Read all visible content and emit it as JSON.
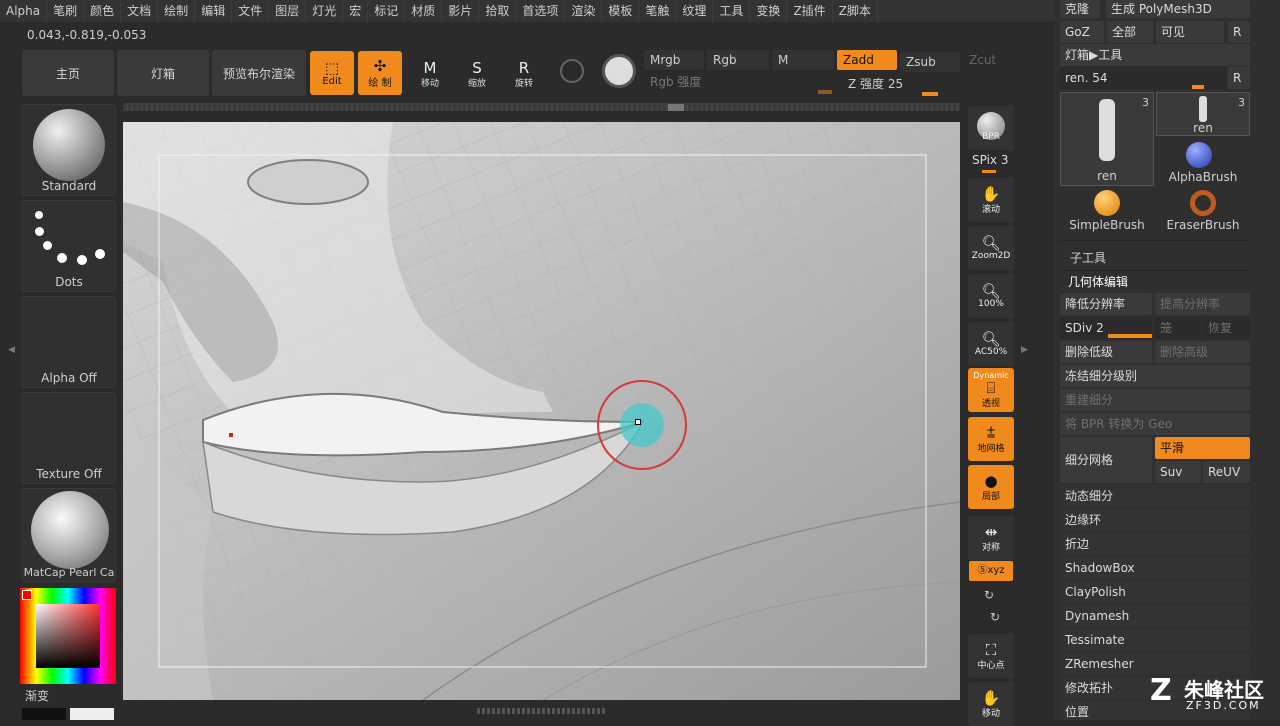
{
  "menu": [
    "Alpha",
    "笔刷",
    "颜色",
    "文档",
    "绘制",
    "编辑",
    "文件",
    "图层",
    "灯光",
    "宏",
    "标记",
    "材质",
    "影片",
    "拾取",
    "首选项",
    "渲染",
    "模板",
    "笔触",
    "纹理",
    "工具",
    "变换",
    "Z插件",
    "Z脚本"
  ],
  "coords": "0.043,-0.819,-0.053",
  "toolbar": {
    "home": "主页",
    "lightbox": "灯箱",
    "bpr_preview": "预览布尔渲染",
    "edit": "Edit",
    "draw": "绘 制",
    "move": "移动",
    "scale": "缩放",
    "rotate": "旋转",
    "mrgb": "Mrgb",
    "rgb": "Rgb",
    "m": "M",
    "zadd": "Zadd",
    "zsub": "Zsub",
    "zcut": "Zcut",
    "rgb_intensity": "Rgb 强度",
    "z_intensity": "Z 强度 25"
  },
  "left": {
    "brush": "Standard",
    "stroke": "Dots",
    "alpha": "Alpha Off",
    "texture": "Texture Off",
    "material": "MatCap Pearl Ca",
    "gradient": "渐变"
  },
  "right_tools": {
    "bpr": "BPR",
    "spix": "SPix 3",
    "scroll": "滚动",
    "zoom2d": "Zoom2D",
    "zoom100": "100%",
    "ac50": "AC50%",
    "dynamic": "Dynamic",
    "persp": "透视",
    "floor": "地网格",
    "local": "局部",
    "frame": "对称",
    "xyz": "Ⓢxyz",
    "center": "中心点",
    "move": "移动"
  },
  "panel": {
    "clone": "克隆",
    "make_polymesh": "生成 PolyMesh3D",
    "goz": "GoZ",
    "all": "全部",
    "visible": "可见",
    "r": "R",
    "lightbox_tools": "灯箱▶工具",
    "ren_slider": "ren. 54",
    "tools": [
      {
        "name": "ren",
        "count": "3"
      },
      {
        "name": "ren",
        "count": "3"
      },
      {
        "name": "AlphaBrush",
        "count": ""
      },
      {
        "name": "SimpleBrush",
        "count": ""
      },
      {
        "name": "EraserBrush",
        "count": ""
      }
    ],
    "subtool": "子工具",
    "geometry": "几何体编辑",
    "lower_res": "降低分辨率",
    "higher_res": "提高分辨率",
    "sdiv": "SDiv 2",
    "cage": "笼",
    "reconstruct": "恢复",
    "del_lower": "删除低级",
    "del_higher": "删除高级",
    "freeze_sub": "冻结细分级别",
    "reconstruct_sub": "重建细分",
    "bpr_to_geo": "将 BPR 转换为 Geo",
    "subdivide": "细分网格",
    "smooth": "平滑",
    "suv": "Suv",
    "reuv": "ReUV",
    "dynamic_sub": "动态细分",
    "edge_loop": "边缘环",
    "crease": "折边",
    "shadowbox": "ShadowBox",
    "claypolish": "ClayPolish",
    "dynamesh": "Dynamesh",
    "tessimate": "Tessimate",
    "zremesher": "ZRemesher",
    "topology": "修改拓扑",
    "position": "位置"
  },
  "watermark": {
    "text": "朱峰社区",
    "url": "ZF3D.COM"
  },
  "colors": {
    "accent": "#f08a1c",
    "bg": "#2b2b2b",
    "panel": "#3a3a3a"
  }
}
